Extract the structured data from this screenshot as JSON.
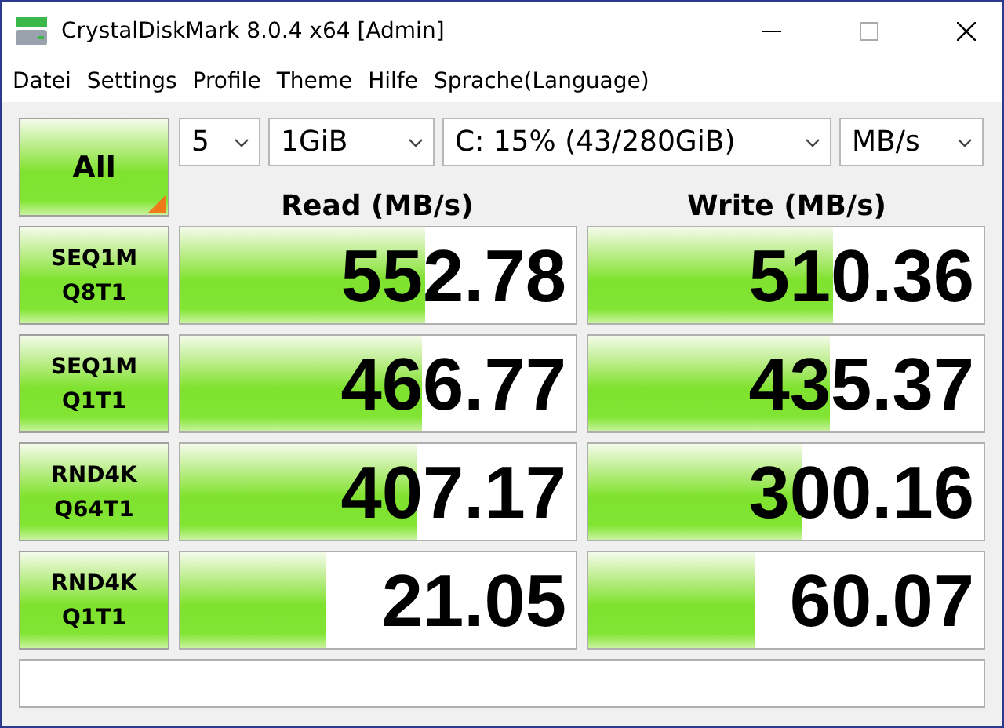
{
  "window": {
    "title": "CrystalDiskMark 8.0.4 x64 [Admin]"
  },
  "menu": [
    "Datei",
    "Settings",
    "Profile",
    "Theme",
    "Hilfe",
    "Sprache(Language)"
  ],
  "all_button": "All",
  "settings": [
    {
      "value": "5"
    },
    {
      "value": "1GiB"
    },
    {
      "value": "C: 15% (43/280GiB)"
    },
    {
      "value": "MB/s"
    }
  ],
  "headers": [
    "Read (MB/s)",
    "Write (MB/s)"
  ],
  "tests": [
    {
      "name": "SEQ1M",
      "params": "Q8T1",
      "read": {
        "value": "552.78",
        "level": 0.62
      },
      "write": {
        "value": "510.36",
        "level": 0.62
      }
    },
    {
      "name": "SEQ1M",
      "params": "Q1T1",
      "read": {
        "value": "466.77",
        "level": 0.61
      },
      "write": {
        "value": "435.37",
        "level": 0.61
      }
    },
    {
      "name": "RND4K",
      "params": "Q64T1",
      "read": {
        "value": "407.17",
        "level": 0.6
      },
      "write": {
        "value": "300.16",
        "level": 0.54
      }
    },
    {
      "name": "RND4K",
      "params": "Q1T1",
      "read": {
        "value": "21.05",
        "level": 0.37
      },
      "write": {
        "value": "60.07",
        "level": 0.42
      }
    }
  ]
}
